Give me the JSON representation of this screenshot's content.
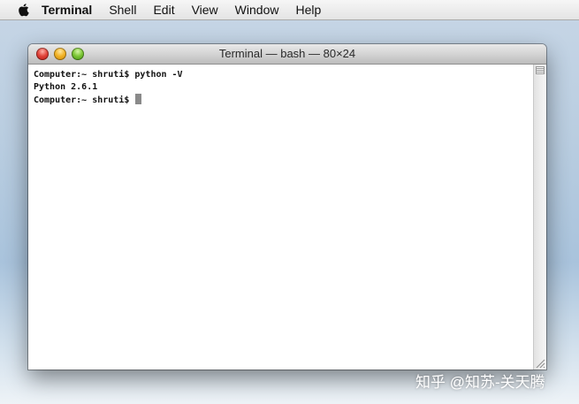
{
  "menubar": {
    "apple_icon": "apple-logo-icon",
    "app_name": "Terminal",
    "items": [
      "Shell",
      "Edit",
      "View",
      "Window",
      "Help"
    ]
  },
  "window": {
    "title": "Terminal — bash — 80×24",
    "buttons": [
      "close",
      "minimize",
      "zoom"
    ],
    "lines": [
      "Computer:~ shruti$ python -V",
      "Python 2.6.1",
      "Computer:~ shruti$ "
    ]
  },
  "watermark": "知乎 @知苏-关天腾",
  "colors": {
    "close": "#e0443a",
    "minimize": "#f2b326",
    "zoom": "#7cc635",
    "cursor": "#8a8a8a"
  }
}
